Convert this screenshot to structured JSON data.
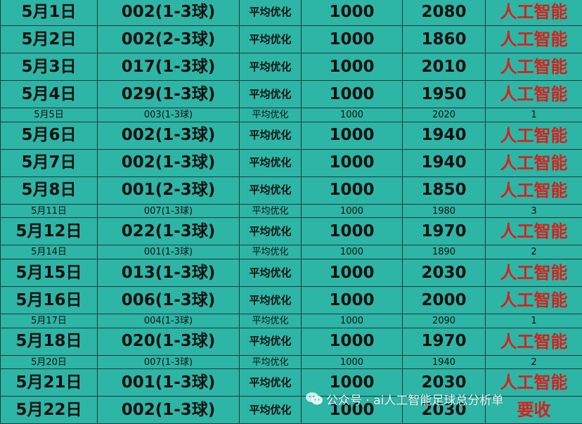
{
  "rows": [
    {
      "date": "5月1日",
      "match": "002(1-3球)",
      "method": "平均优化",
      "stake": "1000",
      "return": "2080",
      "result": "人工智能",
      "size": "big"
    },
    {
      "date": "5月2日",
      "match": "002(2-3球)",
      "method": "平均优化",
      "stake": "1000",
      "return": "1860",
      "result": "人工智能",
      "size": "big"
    },
    {
      "date": "5月3日",
      "match": "017(1-3球)",
      "method": "平均优化",
      "stake": "1000",
      "return": "2010",
      "result": "人工智能",
      "size": "big"
    },
    {
      "date": "5月4日",
      "match": "029(1-3球)",
      "method": "平均优化",
      "stake": "1000",
      "return": "1950",
      "result": "人工智能",
      "size": "big"
    },
    {
      "date": "5月5日",
      "match": "003(1-3球)",
      "method": "平均优化",
      "stake": "1000",
      "return": "2020",
      "result": "1",
      "size": "small"
    },
    {
      "date": "5月6日",
      "match": "002(1-3球)",
      "method": "平均优化",
      "stake": "1000",
      "return": "1940",
      "result": "人工智能",
      "size": "big"
    },
    {
      "date": "5月7日",
      "match": "002(1-3球)",
      "method": "平均优化",
      "stake": "1000",
      "return": "1940",
      "result": "人工智能",
      "size": "big"
    },
    {
      "date": "5月8日",
      "match": "001(2-3球)",
      "method": "平均优化",
      "stake": "1000",
      "return": "1850",
      "result": "人工智能",
      "size": "big"
    },
    {
      "date": "5月11日",
      "match": "007(1-3球)",
      "method": "平均优化",
      "stake": "1000",
      "return": "1980",
      "result": "3",
      "size": "small"
    },
    {
      "date": "5月12日",
      "match": "022(1-3球)",
      "method": "平均优化",
      "stake": "1000",
      "return": "1970",
      "result": "人工智能",
      "size": "big"
    },
    {
      "date": "5月14日",
      "match": "001(1-3球)",
      "method": "平均优化",
      "stake": "1000",
      "return": "1890",
      "result": "2",
      "size": "small"
    },
    {
      "date": "5月15日",
      "match": "013(1-3球)",
      "method": "平均优化",
      "stake": "1000",
      "return": "2030",
      "result": "人工智能",
      "size": "big"
    },
    {
      "date": "5月16日",
      "match": "006(1-3球)",
      "method": "平均优化",
      "stake": "1000",
      "return": "2000",
      "result": "人工智能",
      "size": "big"
    },
    {
      "date": "5月17日",
      "match": "004(1-3球)",
      "method": "平均优化",
      "stake": "1000",
      "return": "2090",
      "result": "1",
      "size": "small"
    },
    {
      "date": "5月18日",
      "match": "020(1-3球)",
      "method": "平均优化",
      "stake": "1000",
      "return": "1970",
      "result": "人工智能",
      "size": "big"
    },
    {
      "date": "5月20日",
      "match": "007(1-3球)",
      "method": "平均优化",
      "stake": "1000",
      "return": "1940",
      "result": "2",
      "size": "small"
    },
    {
      "date": "5月21日",
      "match": "001(1-3球)",
      "method": "平均优化",
      "stake": "1000",
      "return": "2030",
      "result": "人工智能",
      "size": "big"
    },
    {
      "date": "5月22日",
      "match": "002(1-3球)",
      "method": "平均优化",
      "stake": "1000",
      "return": "2030",
      "result": "要收",
      "size": "big"
    }
  ],
  "watermark": {
    "icon": "wechat-icon",
    "text": "公众号 · ai人工智能足球总分析单"
  },
  "colors": {
    "background": "#2db5a6",
    "border": "#1f3a3a",
    "highlight_text": "#d9201b"
  }
}
